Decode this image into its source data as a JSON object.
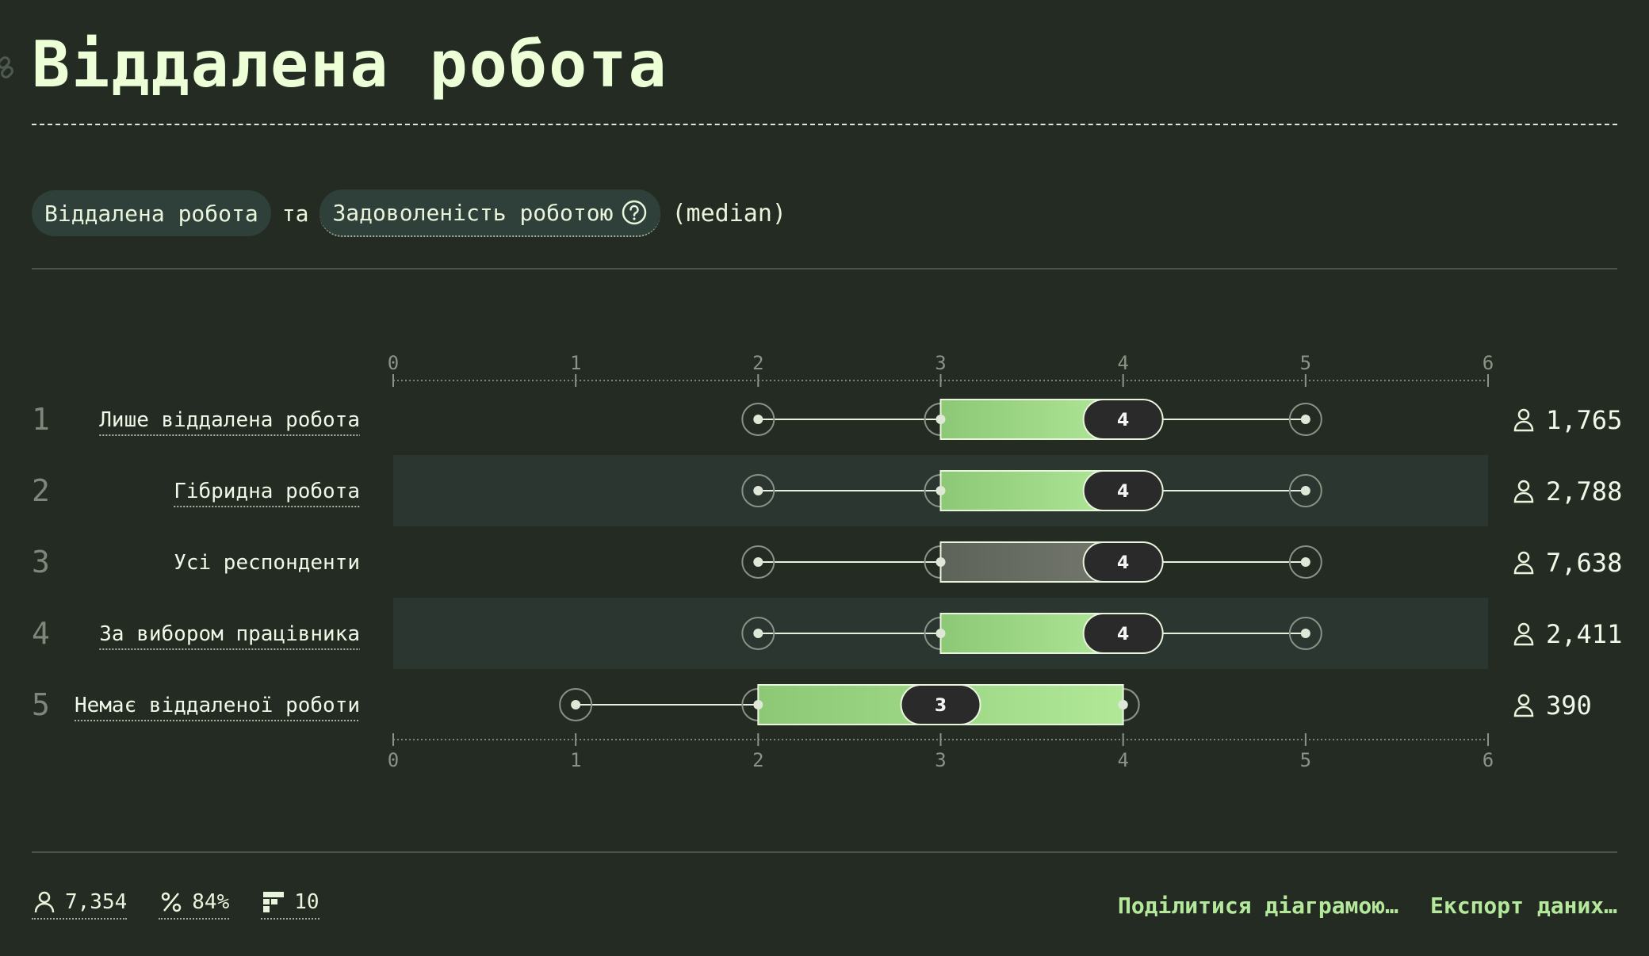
{
  "title": "Віддалена робота",
  "filters": {
    "group_by": "Віддалена робота",
    "conjunction": "та",
    "question": "Задоволеність роботою",
    "aggregate": "(median)"
  },
  "chart_data": {
    "type": "boxplot",
    "x_ticks": [
      0,
      1,
      2,
      3,
      4,
      5,
      6
    ],
    "xlim": [
      0,
      6
    ],
    "rows": [
      {
        "index": "1",
        "label": "Лише віддалена робота",
        "min": 2,
        "q1": 3,
        "median": 4,
        "median_label": "4",
        "q3": 4,
        "max": 5,
        "count": "1,765",
        "highlight": "positive",
        "underlined": true
      },
      {
        "index": "2",
        "label": "Гібридна робота",
        "min": 2,
        "q1": 3,
        "median": 4,
        "median_label": "4",
        "q3": 4,
        "max": 5,
        "count": "2,788",
        "highlight": "positive",
        "underlined": true
      },
      {
        "index": "3",
        "label": "Усі респонденти",
        "min": 2,
        "q1": 3,
        "median": 4,
        "median_label": "4",
        "q3": 4,
        "max": 5,
        "count": "7,638",
        "highlight": "neutral",
        "underlined": false
      },
      {
        "index": "4",
        "label": "За вибором працівника",
        "min": 2,
        "q1": 3,
        "median": 4,
        "median_label": "4",
        "q3": 4,
        "max": 5,
        "count": "2,411",
        "highlight": "positive",
        "underlined": true
      },
      {
        "index": "5",
        "label": "Немає віддаленої роботи",
        "min": 1,
        "q1": 2,
        "median": 3,
        "median_label": "3",
        "q3": 4,
        "max": 4,
        "count": "390",
        "highlight": "positive",
        "underlined": true
      }
    ]
  },
  "stats": {
    "respondents": "7,354",
    "percent": "84%",
    "questions": "10"
  },
  "actions": {
    "share": "Поділитися діаграмою…",
    "export": "Експорт даних…"
  },
  "colors": {
    "background": "#232b23",
    "box_gradient_start": "#8cc876",
    "box_gradient_end": "#b0e898",
    "neutral_box": "#6a6e66",
    "stripe": "#2c3630",
    "accent": "#b4e89a"
  }
}
